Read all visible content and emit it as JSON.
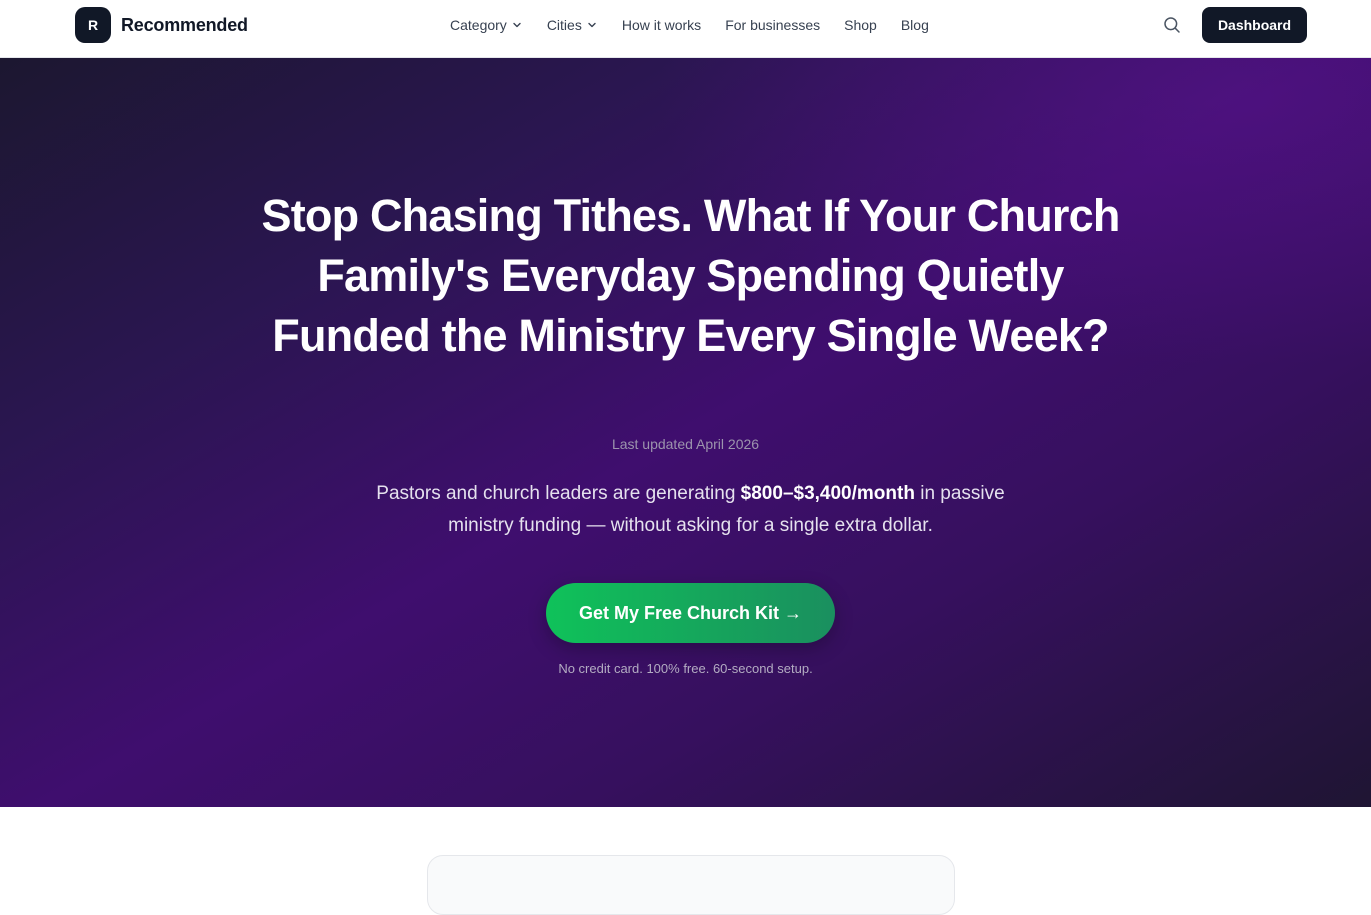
{
  "nav": {
    "brand_mark": "R",
    "brand_name": "Recommended",
    "links": [
      {
        "label": "Category",
        "dropdown": true
      },
      {
        "label": "Cities",
        "dropdown": true
      },
      {
        "label": "How it works",
        "dropdown": false
      },
      {
        "label": "For businesses",
        "dropdown": false
      },
      {
        "label": "Shop",
        "dropdown": false
      },
      {
        "label": "Blog",
        "dropdown": false
      }
    ],
    "search_icon": "search-icon",
    "dashboard_label": "Dashboard"
  },
  "hero": {
    "title": "Stop Chasing Tithes. What If Your Church Family's Everyday Spending Quietly Funded the Ministry Every Single Week?",
    "updated": "Last updated April 2026",
    "lede_before": "Pastors and church leaders are generating ",
    "lede_highlight": "$800–$3,400/month",
    "lede_after": " in passive ministry funding — without asking for a single extra dollar.",
    "cta_label": "Get My Free Church Kit →",
    "fine_print": "No credit card. 100% free. 60-second setup."
  },
  "colors": {
    "dark": "#111827",
    "hero_purple": "#3f0e6e",
    "cta_green": "#0fc25a"
  }
}
